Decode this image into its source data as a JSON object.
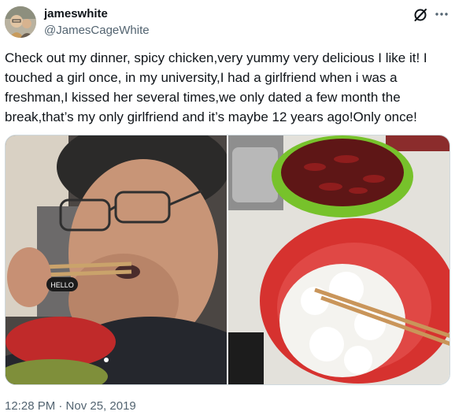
{
  "user": {
    "display_name": "jameswhite",
    "handle": "@JamesCageWhite"
  },
  "icons": {
    "grok": "grok-icon",
    "more": "more-icon"
  },
  "tweet": {
    "text": "Check out my dinner, spicy chicken,very yummy very delicious I like it! I touched a girl once, in my university,I had a girlfriend when i was a freshman,I kissed her several times,we only dated a few month the break,that’s my only girlfriend and it’s maybe 12 years ago!Only once!",
    "timestamp": "12:28 PM · Nov 25, 2019"
  },
  "media": {
    "left_photo_sign": "HELLO"
  }
}
